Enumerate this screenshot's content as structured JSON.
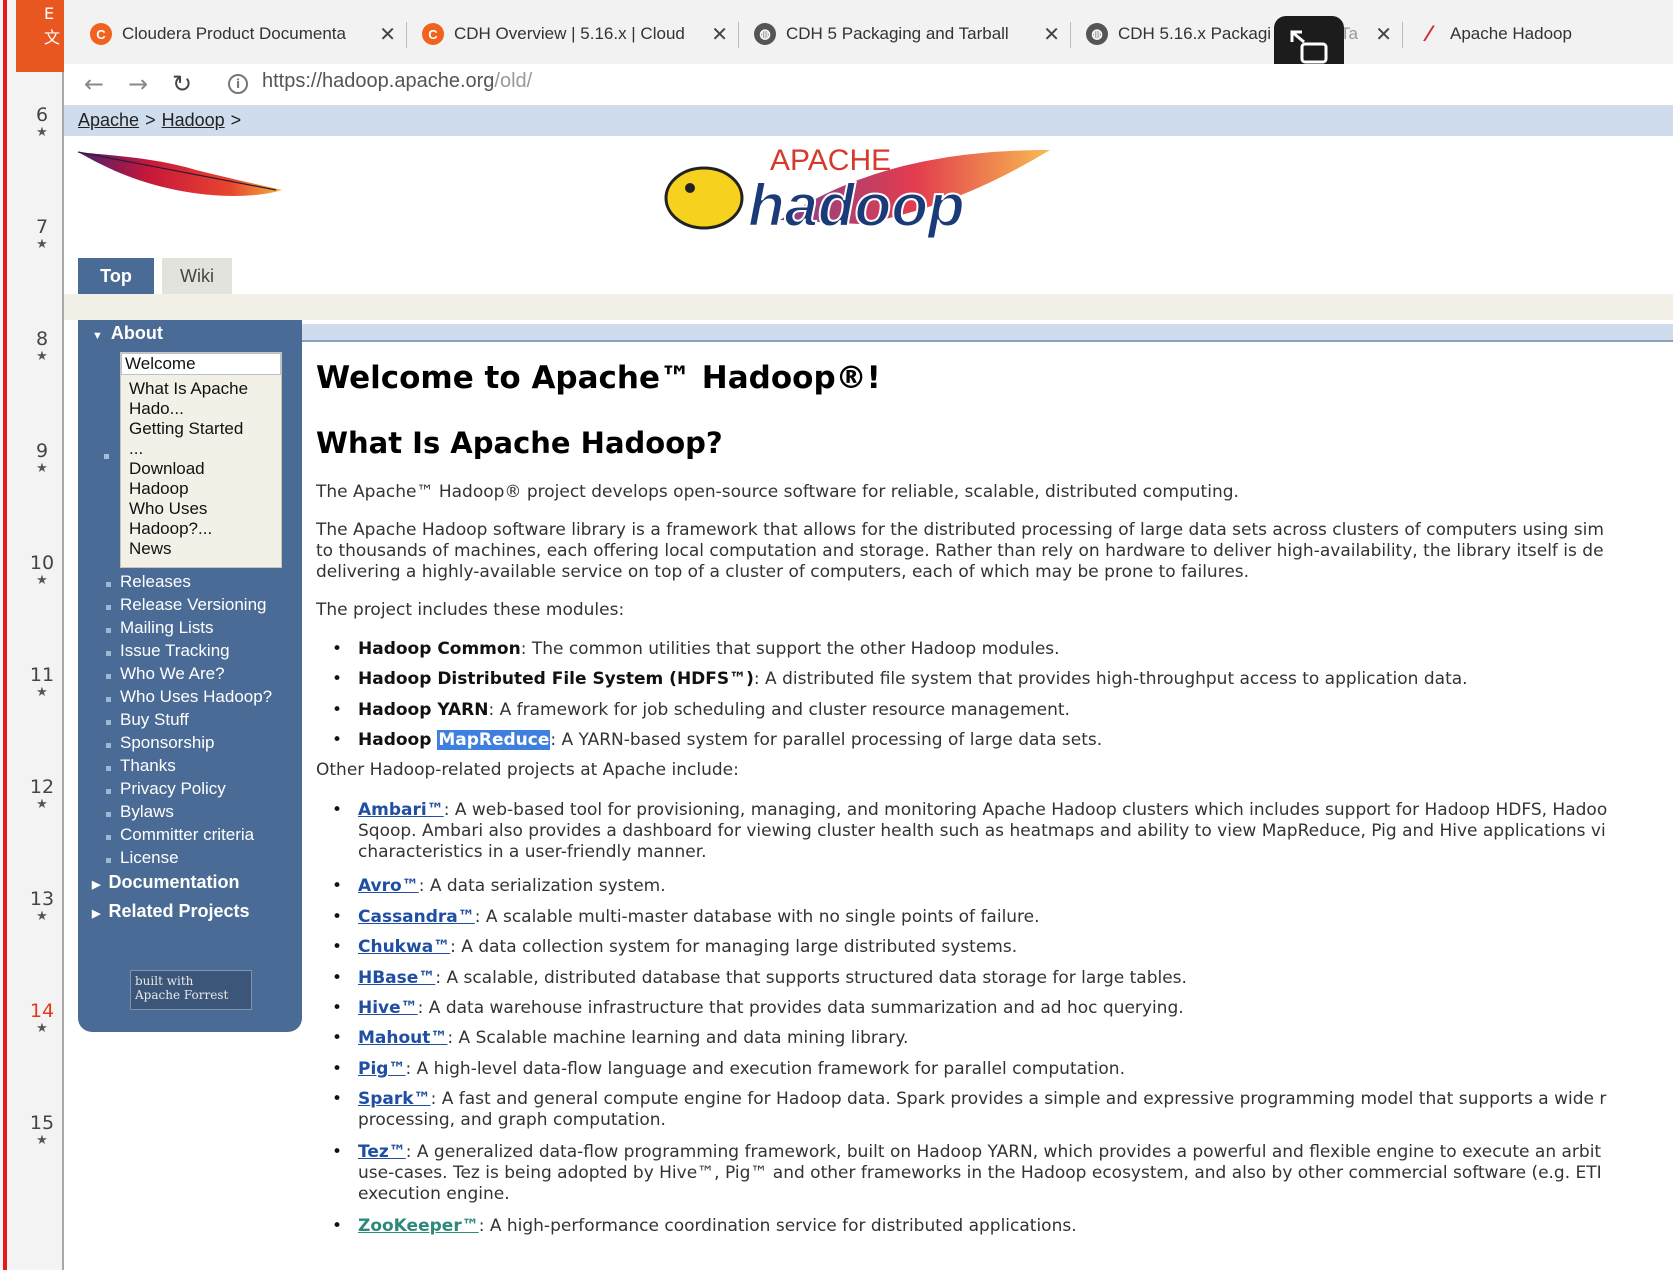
{
  "browser": {
    "tabs": [
      {
        "title": "Cloudera Product Documenta",
        "icon": "cloudera-icon"
      },
      {
        "title": "CDH Overview | 5.16.x | Cloud",
        "icon": "cloudera-icon"
      },
      {
        "title": "CDH 5 Packaging and Tarball",
        "icon": "globe-icon"
      },
      {
        "title": "CDH 5.16.x Packagi",
        "tail": "Ta",
        "icon": "globe-icon"
      },
      {
        "title": "Apache Hadoop",
        "icon": "apache-feather-icon"
      }
    ],
    "url_host": "https://hadoop.apache.org",
    "url_path": "/old/"
  },
  "outline": {
    "line_numbers": [
      "6",
      "7",
      "8",
      "9",
      "10",
      "11",
      "12",
      "13",
      "14",
      "15"
    ],
    "star": "★"
  },
  "breadcrumb": {
    "items": [
      "Apache",
      "Hadoop"
    ],
    "sep": ">"
  },
  "logo": {
    "apache_text": "APACHE",
    "hadoop_text": "hadoop"
  },
  "page_tabs": {
    "top": "Top",
    "wiki": "Wiki"
  },
  "sidebar": {
    "about": "About",
    "welcome": "Welcome",
    "sub_items": [
      "What Is Apache",
      "Hado...",
      "Getting Started",
      "...",
      "Download",
      "Hadoop",
      "Who Uses",
      "Hadoop?...",
      "News"
    ],
    "links": [
      "Releases",
      "Release Versioning",
      "Mailing Lists",
      "Issue Tracking",
      "Who We Are?",
      "Who Uses Hadoop?",
      "Buy Stuff",
      "Sponsorship",
      "Thanks",
      "Privacy Policy",
      "Bylaws",
      "Committer criteria",
      "License"
    ],
    "documentation": "Documentation",
    "related_projects": "Related Projects",
    "badge": {
      "line1": "built with",
      "line2": "Apache Forrest"
    }
  },
  "content": {
    "title": "Welcome to Apache™ Hadoop®!",
    "subtitle": "What Is Apache Hadoop?",
    "intro": "The Apache™ Hadoop® project develops open-source software for reliable, scalable, distributed computing.",
    "desc_lines": [
      "The Apache Hadoop software library is a framework that allows for the distributed processing of large data sets across clusters of computers using sim",
      "to thousands of machines, each offering local computation and storage. Rather than rely on hardware to deliver high-availability, the library itself is de",
      "delivering a highly-available service on top of a cluster of computers, each of which may be prone to failures."
    ],
    "modules_intro": "The project includes these modules:",
    "modules": [
      {
        "name": "Hadoop Common",
        "desc": ": The common utilities that support the other Hadoop modules."
      },
      {
        "name": "Hadoop Distributed File System (HDFS™)",
        "desc": ": A distributed file system that provides high-throughput access to application data."
      },
      {
        "name": "Hadoop YARN",
        "desc": ": A framework for job scheduling and cluster resource management."
      },
      {
        "name": "Hadoop ",
        "highlight": "MapReduce",
        "desc": ": A YARN-based system for parallel processing of large data sets."
      }
    ],
    "other_intro": "Other Hadoop-related projects at Apache include:",
    "projects": [
      {
        "name": "Ambari™",
        "lines": [
          ": A web-based tool for provisioning, managing, and monitoring Apache Hadoop clusters which includes support for Hadoop HDFS, Hadoo",
          "Sqoop. Ambari also provides a dashboard for viewing cluster health such as heatmaps and ability to view MapReduce, Pig and Hive applications vi",
          "characteristics in a user-friendly manner."
        ]
      },
      {
        "name": "Avro™",
        "lines": [
          ": A data serialization system."
        ]
      },
      {
        "name": "Cassandra™",
        "lines": [
          ": A scalable multi-master database with no single points of failure."
        ]
      },
      {
        "name": "Chukwa™",
        "lines": [
          ": A data collection system for managing large distributed systems."
        ]
      },
      {
        "name": "HBase™",
        "lines": [
          ": A scalable, distributed database that supports structured data storage for large tables."
        ]
      },
      {
        "name": "Hive™",
        "lines": [
          ": A data warehouse infrastructure that provides data summarization and ad hoc querying."
        ]
      },
      {
        "name": "Mahout™",
        "lines": [
          ": A Scalable machine learning and data mining library."
        ]
      },
      {
        "name": "Pig™",
        "lines": [
          ": A high-level data-flow language and execution framework for parallel computation."
        ]
      },
      {
        "name": "Spark™",
        "lines": [
          ": A fast and general compute engine for Hadoop data. Spark provides a simple and expressive programming model that supports a wide r",
          "processing, and graph computation."
        ]
      },
      {
        "name": "Tez™",
        "lines": [
          ": A generalized data-flow programming framework, built on Hadoop YARN, which provides a powerful and flexible engine to execute an arbit",
          "use-cases. Tez is being adopted by Hive™, Pig™ and other frameworks in the Hadoop ecosystem, and also by other commercial software (e.g. ETI",
          "execution engine."
        ]
      },
      {
        "name": "ZooKeeper™",
        "lines": [
          ": A high-performance coordination service for distributed applications."
        ]
      }
    ]
  },
  "colors": {
    "sidebar": "#4a6b95",
    "breadcrumb": "#cfdced",
    "link": "#1f4ea3",
    "highlight": "#3f7fe0",
    "cloudera": "#f0621e"
  }
}
